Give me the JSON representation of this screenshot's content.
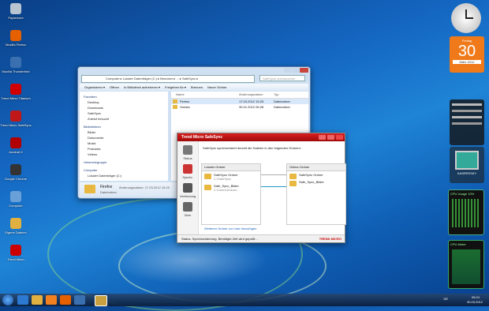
{
  "desktop_icons": [
    {
      "label": "Papierkorb",
      "color": "#b8c4d0"
    },
    {
      "label": "Mozilla Firefox",
      "color": "#e66000"
    },
    {
      "label": "Mozilla Thunderbird",
      "color": "#3a6fb0"
    },
    {
      "label": "Trend Micro Titanium",
      "color": "#d00000"
    },
    {
      "label": "Trend Micro SafeSync",
      "color": "#c01818"
    },
    {
      "label": "Acrobat X",
      "color": "#b00000"
    },
    {
      "label": "Google Chrome",
      "color": "#333"
    },
    {
      "label": "Computer",
      "color": "#6aa0d8"
    },
    {
      "label": "Eigene Dateien",
      "color": "#e0b040"
    },
    {
      "label": "Trend Micro",
      "color": "#c00"
    }
  ],
  "calendar": {
    "weekday": "Freitag",
    "day": "30",
    "month": "März 2012"
  },
  "gadgets": {
    "kaspersky": "KASPERSKY",
    "cpu": "CPU Usage 10%",
    "ram": "CPU Meter"
  },
  "explorer": {
    "breadcrumb": "Computer ▸ Lokaler Datenträger (C:) ▸ Benutzer ▸ ... ▸ SafeSync ▸",
    "search_placeholder": "SafeSync durchsuchen",
    "toolbar": [
      "Organisieren ▾",
      "Öffnen",
      "In Bibliothek aufnehmen ▾",
      "Freigeben für ▾",
      "Brennen",
      "Neuer Ordner"
    ],
    "nav_groups": [
      {
        "header": "Favoriten",
        "items": [
          "Desktop",
          "Downloads",
          "SafeSync",
          "Zuletzt besucht"
        ]
      },
      {
        "header": "Bibliotheken",
        "items": [
          "Bilder",
          "Dokumente",
          "Musik",
          "Podcasts",
          "Videos"
        ]
      },
      {
        "header": "Heimnetzgruppe",
        "items": []
      },
      {
        "header": "Computer",
        "items": [
          "Lokaler Datenträger (C:)"
        ]
      }
    ],
    "columns": [
      "Name",
      "Änderungsdatum",
      "Typ"
    ],
    "rows": [
      {
        "name": "Firefox",
        "date": "17.03.2012 15:25",
        "type": "Dateiordner"
      },
      {
        "name": "Guides",
        "date": "30.01.2012 06:28",
        "type": "Dateiordner"
      }
    ],
    "details": {
      "name": "Firefox",
      "meta": "Änderungsdatum: 17.03.2012 15:25",
      "kind": "Dateiordner"
    }
  },
  "safesync": {
    "title": "Trend Micro SafeSync",
    "sidebar": [
      "Status",
      "Synchr.",
      "Verbindung",
      "Über"
    ],
    "headline": "SafeSync synchronisiert derzeit die Dateien in den folgenden Ordnern:",
    "local_header": "Lokaler Ordner",
    "online_header": "Online-Ordner",
    "local": [
      {
        "name": "SafeSync Ordner",
        "sub": "C:\\SafeSync"
      },
      {
        "name": "Safe_Sync_Bilder",
        "sub": "C:\\Users\\Dokum..."
      }
    ],
    "online": [
      {
        "name": "SafeSync Ordner"
      },
      {
        "name": "Safe_Sync_Bilder"
      }
    ],
    "add_link": "Weiteren Ordner zur Liste hinzufügen",
    "status": "Status: Synchronisierung. Benötigte Zeit wird geprüft...",
    "brand": "TREND MICRO"
  },
  "clock": {
    "time": "06:24",
    "date": "30.03.2012",
    "lang": "DE"
  }
}
